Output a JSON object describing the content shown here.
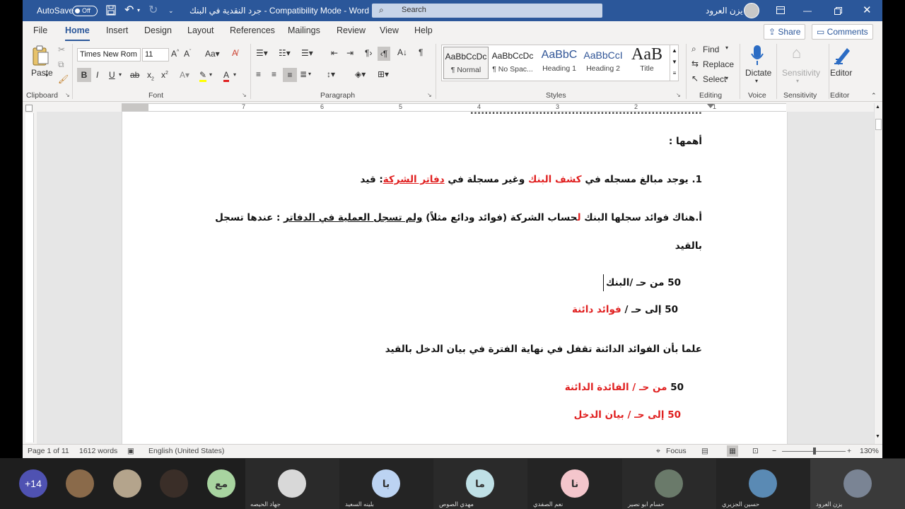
{
  "titlebar": {
    "autosave_label": "AutoSave",
    "autosave_state": "Off",
    "doc_title": "جرد النقدية في البنك  -  Compatibility Mode  -  Word",
    "search_placeholder": "Search",
    "user_name": "يزن العرود"
  },
  "tabs": [
    "File",
    "Home",
    "Insert",
    "Design",
    "Layout",
    "References",
    "Mailings",
    "Review",
    "View",
    "Help"
  ],
  "active_tab": "Home",
  "share_label": "Share",
  "comments_label": "Comments",
  "ribbon": {
    "paste_label": "Paste",
    "font_name": "Times New Rom",
    "font_size": "11",
    "styles": [
      {
        "preview": "AaBbCcDc",
        "name": "¶ Normal"
      },
      {
        "preview": "AaBbCcDc",
        "name": "¶ No Spac..."
      },
      {
        "preview": "AaBbC",
        "name": "Heading 1"
      },
      {
        "preview": "AaBbCcI",
        "name": "Heading 2"
      },
      {
        "preview": "AaB",
        "name": "Title"
      }
    ],
    "find_label": "Find",
    "replace_label": "Replace",
    "select_label": "Select",
    "dictate_label": "Dictate",
    "sensitivity_label": "Sensitivity",
    "editor_label": "Editor",
    "groups": {
      "clipboard": "Clipboard",
      "font": "Font",
      "paragraph": "Paragraph",
      "styles": "Styles",
      "editing": "Editing",
      "voice": "Voice",
      "sensitivity": "Sensitivity",
      "editor": "Editor"
    }
  },
  "ruler_numbers": [
    "7",
    "6",
    "5",
    "4",
    "3",
    "2",
    "1"
  ],
  "document": {
    "l0": "أهمها :",
    "l1_a": "1. يوجد مبالغ مسجله في ",
    "l1_b": "كشف البنك",
    "l1_c": " وغير مسجلة في ",
    "l1_d": "دفاتر الشركة",
    "l1_e": ": قيد",
    "l2_a": "أ.هناك فوائد سجلها البنك ",
    "l2_b": "ل",
    "l2_c": "حساب الشركة (فوائد ودائع مثلاً) ",
    "l2_d": "ولم تسجل العملية في الدفاتر",
    "l2_e": " : عندها تسجل",
    "l3": "بالقيد",
    "e1": "50 من حـ /البنك",
    "e2_a": "50 إلى حـ / ",
    "e2_b": "فوائد دائنة",
    "l4": "علما بأن الفوائد الدائنة تقفل في نهاية الفترة في بيان الدخل بالقيد",
    "e3_a": "50 ",
    "e3_b": "من حـ / الفائدة الدائنة",
    "e4_a": "50 ",
    "e4_b": "إلى حـ / ",
    "e4_c": "بيان الدخل"
  },
  "status": {
    "page": "Page 1 of 11",
    "words": "1612 words",
    "language": "English (United States)",
    "focus": "Focus",
    "zoom": "130%"
  },
  "meeting": {
    "more_count": "+14",
    "participants": [
      {
        "initials": "مع",
        "name": ""
      },
      {
        "initials": "",
        "name": "جهاد الحيصه"
      },
      {
        "initials": "با",
        "name": "بلينه السعيد"
      },
      {
        "initials": "ما",
        "name": "مهدي الصوص"
      },
      {
        "initials": "نا",
        "name": "نعم الصفدي"
      },
      {
        "initials": "",
        "name": "حسام ابو نصير"
      },
      {
        "initials": "",
        "name": "حسين الجزيري"
      },
      {
        "initials": "",
        "name": "يزن العرود"
      }
    ]
  },
  "colors": {
    "word_blue": "#2b579a",
    "accent_red": "#e02020"
  }
}
